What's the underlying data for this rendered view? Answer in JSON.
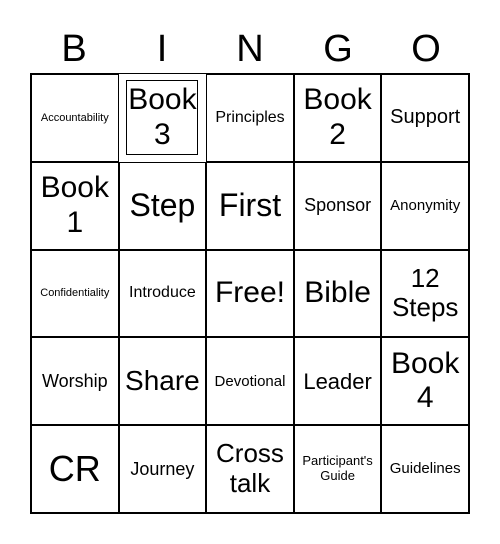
{
  "header": [
    "B",
    "I",
    "N",
    "G",
    "O"
  ],
  "cells": [
    [
      "Accountability",
      "Book 3",
      "Principles",
      "Book 2",
      "Support"
    ],
    [
      "Book 1",
      "Step",
      "First",
      "Sponsor",
      "Anonymity"
    ],
    [
      "Confidentiality",
      "Introduce",
      "Free!",
      "Bible",
      "12 Steps"
    ],
    [
      "Worship",
      "Share",
      "Devotional",
      "Leader",
      "Book 4"
    ],
    [
      "CR",
      "Journey",
      "Cross talk",
      "Participant's Guide",
      "Guidelines"
    ]
  ]
}
